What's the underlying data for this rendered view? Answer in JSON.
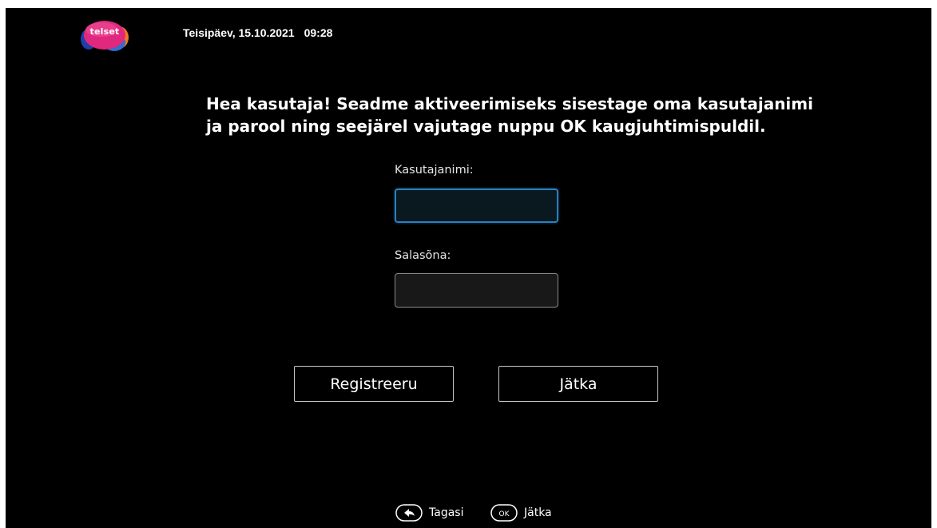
{
  "header": {
    "logo_text": "telset",
    "date": "Teisipäev, 15.10.2021",
    "time": "09:28"
  },
  "instructions": {
    "line1": "Hea kasutaja! Seadme aktiveerimiseks sisestage oma kasutajanimi",
    "line2": "ja parool ning seejärel vajutage nuppu OK kaugjuhtimispuldil."
  },
  "form": {
    "username_label": "Kasutajanimi:",
    "username_value": "",
    "password_label": "Salasõna:",
    "password_value": ""
  },
  "buttons": {
    "register_label": "Registreeru",
    "continue_label": "Jätka"
  },
  "footer_hints": {
    "back_label": "Tagasi",
    "back_icon": "back-arrow-icon",
    "ok_icon_text": "OK",
    "ok_label": "Jätka"
  },
  "colors": {
    "background": "#000000",
    "focus_border": "#2a80c0",
    "text": "#ffffff"
  }
}
